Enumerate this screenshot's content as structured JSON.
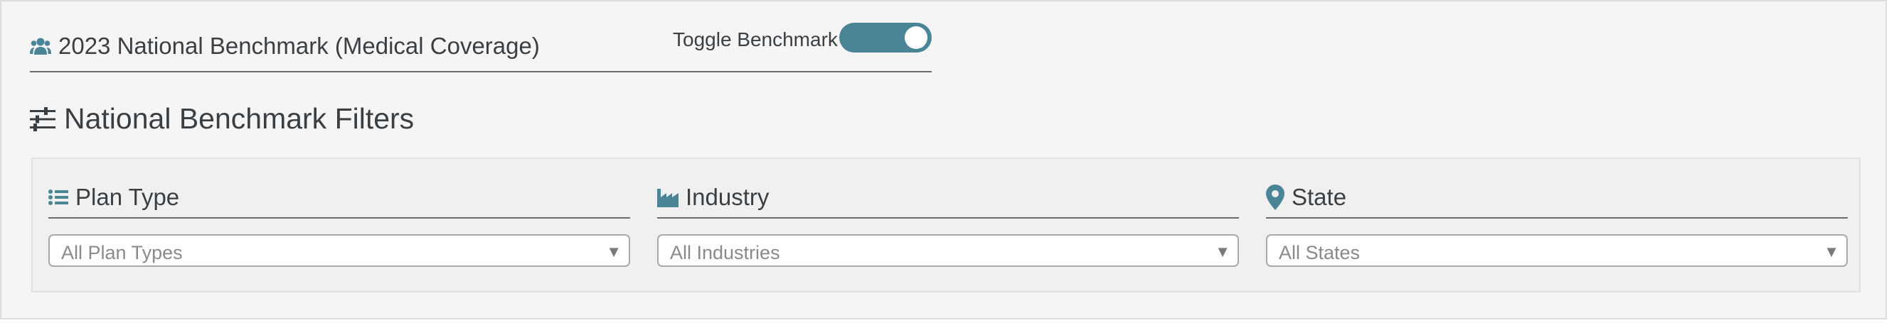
{
  "benchmark": {
    "title": "2023 National Benchmark (Medical Coverage)",
    "toggle_label": "Toggle Benchmark",
    "toggle_on": true
  },
  "filters_section": {
    "title": "National Benchmark Filters",
    "filters": [
      {
        "label": "Plan Type",
        "icon": "list-icon",
        "selected": "All Plan Types"
      },
      {
        "label": "Industry",
        "icon": "industry-icon",
        "selected": "All Industries"
      },
      {
        "label": "State",
        "icon": "map-marker-icon",
        "selected": "All States"
      }
    ]
  },
  "colors": {
    "accent": "#4a8597",
    "text": "#3a3f44",
    "placeholder": "#8a8a8a"
  }
}
